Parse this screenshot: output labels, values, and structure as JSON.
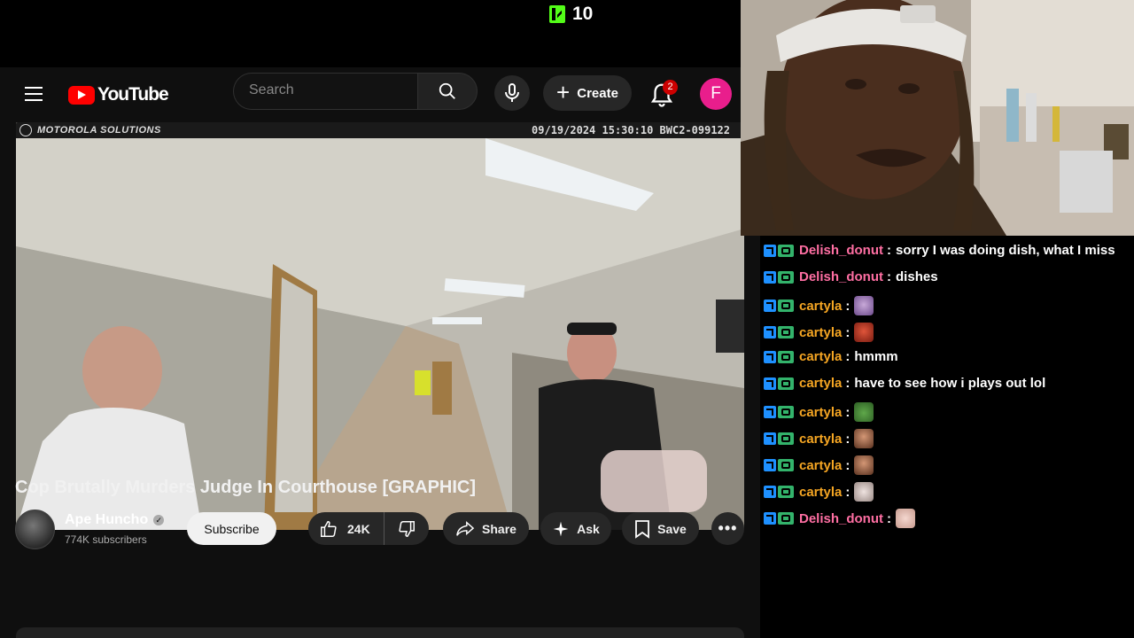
{
  "stream": {
    "viewer_count": "10"
  },
  "youtube": {
    "logo_text": "YouTube",
    "search_placeholder": "Search",
    "create_label": "Create",
    "notification_count": "2",
    "avatar_letter": "F"
  },
  "video": {
    "watermark": "MOTOROLA SOLUTIONS",
    "timestamp": "09/19/2024 15:30:10 BWC2-099122",
    "title": "Cop Brutally Murders Judge In Courthouse [GRAPHIC]",
    "channel_name": "Ape Huncho",
    "channel_subscribers": "774K subscribers",
    "subscribe_label": "Subscribe",
    "like_count": "24K",
    "share_label": "Share",
    "ask_label": "Ask",
    "save_label": "Save"
  },
  "chat": {
    "messages": [
      {
        "user": "Delish_donut",
        "color": "#ff6fa3",
        "text": "sorry I was doing dish, what I miss",
        "emote": ""
      },
      {
        "user": "Delish_donut",
        "color": "#ff6fa3",
        "text": "dishes",
        "emote": ""
      },
      {
        "user": "cartyla",
        "color": "#f6a623",
        "text": "",
        "emote": "purple-face-emote"
      },
      {
        "user": "cartyla",
        "color": "#f6a623",
        "text": "",
        "emote": "angry-face-emote"
      },
      {
        "user": "cartyla",
        "color": "#f6a623",
        "text": "hmmm",
        "emote": ""
      },
      {
        "user": "cartyla",
        "color": "#f6a623",
        "text": "have to see how i plays out lol",
        "emote": ""
      },
      {
        "user": "cartyla",
        "color": "#f6a623",
        "text": "",
        "emote": "frog-emote"
      },
      {
        "user": "cartyla",
        "color": "#f6a623",
        "text": "",
        "emote": "bearded-face-emote"
      },
      {
        "user": "cartyla",
        "color": "#f6a623",
        "text": "",
        "emote": "bearded-face-emote"
      },
      {
        "user": "cartyla",
        "color": "#f6a623",
        "text": "",
        "emote": "cat-emote"
      },
      {
        "user": "Delish_donut",
        "color": "#ff6fa3",
        "text": "",
        "emote": "hands-emote"
      }
    ]
  }
}
